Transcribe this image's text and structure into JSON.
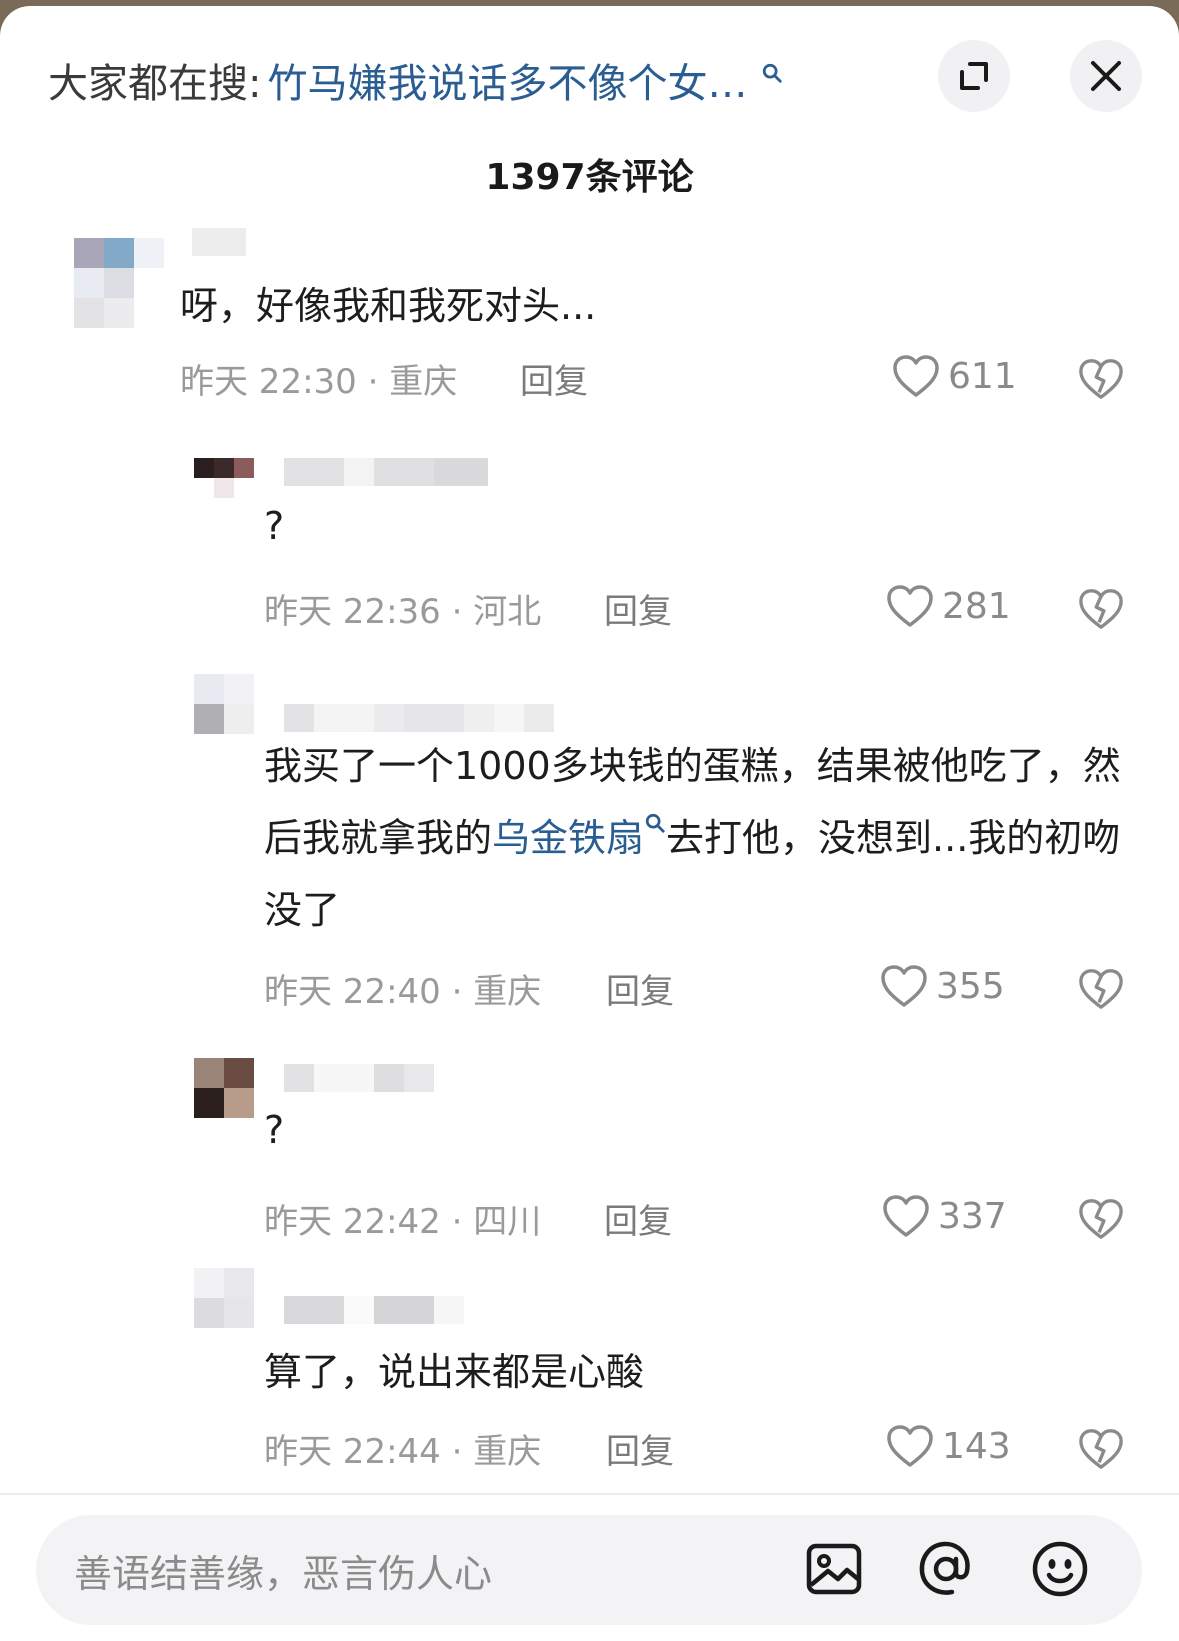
{
  "header": {
    "search_prefix": "大家都在搜:",
    "search_query": "竹马嫌我说话多不像个女…",
    "comment_count": "1397条评论"
  },
  "comments": [
    {
      "text": "呀，好像我和我死对头...",
      "time": "昨天 22:30 · 重庆",
      "reply_label": "回复",
      "likes": "611"
    },
    {
      "text": "?",
      "time": "昨天 22:36 · 河北",
      "reply_label": "回复",
      "likes": "281"
    },
    {
      "text_before": "我买了一个1000多块钱的蛋糕，结果被他吃了，然后我就拿我的",
      "text_link": "乌金铁扇",
      "text_after": "去打他，没想到...我的初吻没了",
      "time": "昨天 22:40 · 重庆",
      "reply_label": "回复",
      "likes": "355"
    },
    {
      "text": "?",
      "time": "昨天 22:42 · 四川",
      "reply_label": "回复",
      "likes": "337"
    },
    {
      "text": "算了，说出来都是心酸",
      "time": "昨天 22:44 · 重庆",
      "reply_label": "回复",
      "likes": "143"
    }
  ],
  "input": {
    "placeholder": "善语结善缘，恶言伤人心"
  },
  "icons": {
    "search": "search-icon",
    "expand": "expand-icon",
    "close": "close-icon",
    "like": "heart-icon",
    "dislike": "broken-heart-icon",
    "image": "image-icon",
    "mention": "at-icon",
    "emoji": "emoji-icon"
  },
  "colors": {
    "link": "#2a5d92",
    "meta": "#9a9a9a",
    "background": "#ffffff"
  }
}
